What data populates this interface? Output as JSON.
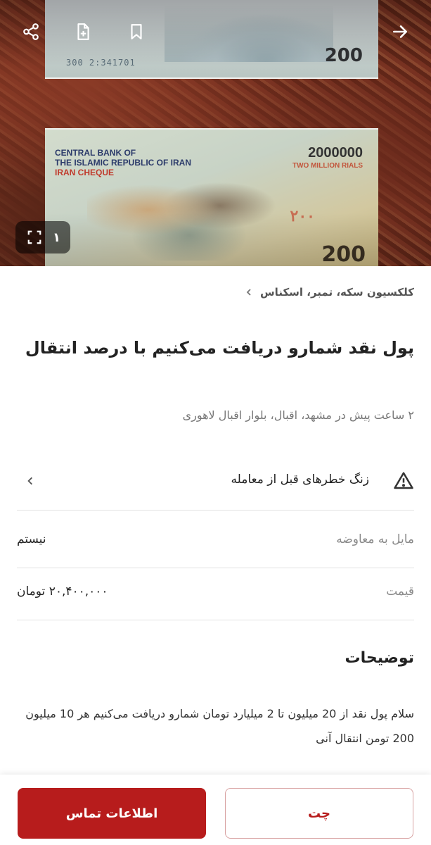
{
  "hero": {
    "note_top_value": "200",
    "note_top_serial": "300 2:341701",
    "note_bottom_bank_line1": "CENTRAL BANK OF",
    "note_bottom_bank_line2": "THE ISLAMIC REPUBLIC OF IRAN",
    "note_bottom_cheque": "IRAN CHEQUE",
    "note_bottom_amount": "2000000",
    "note_bottom_amount_words": "TWO MILLION RIALS",
    "note_bottom_value": "200",
    "photo_counter": "۱"
  },
  "breadcrumb": "کلکسیون سکه، تمبر، اسکناس",
  "title": "پول نقد شمارو دریافت می‌کنیم با درصد انتقال",
  "meta": "۲ ساعت پیش در مشهد، اقبال، بلوار اقبال لاهوری",
  "risk_label": "زنگ خطرهای قبل از معامله",
  "fields": {
    "exchange_label": "مایل به معاوضه",
    "exchange_value": "نیستم",
    "price_label": "قیمت",
    "price_value": "۲۰,۴۰۰,۰۰۰ تومان"
  },
  "description_title": "توضیحات",
  "description": "سلام پول نقد از 20 میلیون تا 2 میلیارد تومان شمارو دریافت می‌کنیم هر 10 میلیون 200 تومن انتقال آنی",
  "actions": {
    "contact_label": "اطلاعات تماس",
    "chat_label": "چت"
  },
  "colors": {
    "accent": "#b71c1c"
  }
}
